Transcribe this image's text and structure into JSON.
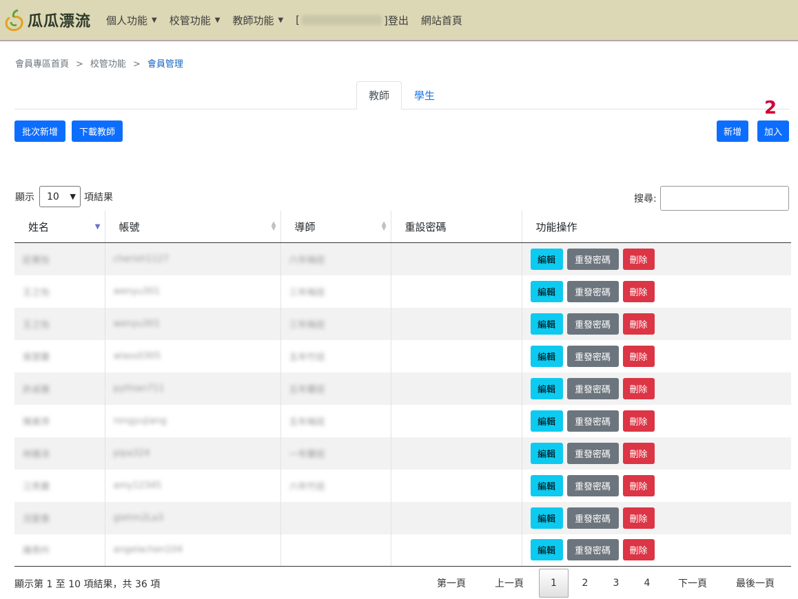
{
  "header": {
    "logo_text": "瓜瓜漂流",
    "menu": [
      "個人功能",
      "校管功能",
      "教師功能"
    ],
    "user_open": "[",
    "user_name": "angelachen104",
    "user_close": "]登出",
    "home_link": "網站首頁"
  },
  "breadcrumb": {
    "items": [
      "會員專區首頁",
      "校管功能"
    ],
    "current": "會員管理",
    "separator": ">"
  },
  "tabs": [
    {
      "label": "教師",
      "active": true
    },
    {
      "label": "學生",
      "active": false
    }
  ],
  "annotation": "2",
  "toolbar": {
    "batch_add": "批次新增",
    "download_teachers": "下載教師",
    "add_new": "新增",
    "join": "加入"
  },
  "table_controls": {
    "show_label": "顯示",
    "page_length": "10",
    "results_label": "項結果",
    "search_label": "搜尋:"
  },
  "table": {
    "headers": [
      "姓名",
      "帳號",
      "導師",
      "重設密碼",
      "功能操作"
    ],
    "rows": [
      {
        "name": "莊覺怡",
        "account": "cherish1127",
        "homeroom": "六年梅班"
      },
      {
        "name": "王之怡",
        "account": "wenyu301",
        "homeroom": "三年梅班"
      },
      {
        "name": "王之怡",
        "account": "wenyu301",
        "homeroom": "三年梅班"
      },
      {
        "name": "張慧蘭",
        "account": "wlass0305",
        "homeroom": "五年竹班"
      },
      {
        "name": "許貞雅",
        "account": "pythian711",
        "homeroom": "五年蘭班"
      },
      {
        "name": "陳美萍",
        "account": "rongyujiang",
        "homeroom": "五年梅班"
      },
      {
        "name": "林雅涼",
        "account": "pipa324",
        "homeroom": "一年蘭班"
      },
      {
        "name": "江秀蘭",
        "account": "amy12345",
        "homeroom": "六年竹班"
      },
      {
        "name": "況愛惠",
        "account": "glehm2La3",
        "homeroom": ""
      },
      {
        "name": "陳秀吟",
        "account": "angelachen104",
        "homeroom": ""
      }
    ],
    "actions": {
      "edit": "編輯",
      "reset": "重發密碼",
      "delete": "刪除"
    }
  },
  "footer": {
    "info": "顯示第 1 至 10 項結果，共 36 項",
    "first": "第一頁",
    "prev": "上一頁",
    "pages": [
      "1",
      "2",
      "3",
      "4"
    ],
    "next": "下一頁",
    "last": "最後一頁"
  },
  "colors": {
    "topbar": "#dcd7b4",
    "primary": "#0d6efd",
    "info": "#0dcaf0",
    "secondary": "#6c757d",
    "danger": "#dc3545",
    "annotation": "#d0003a"
  }
}
